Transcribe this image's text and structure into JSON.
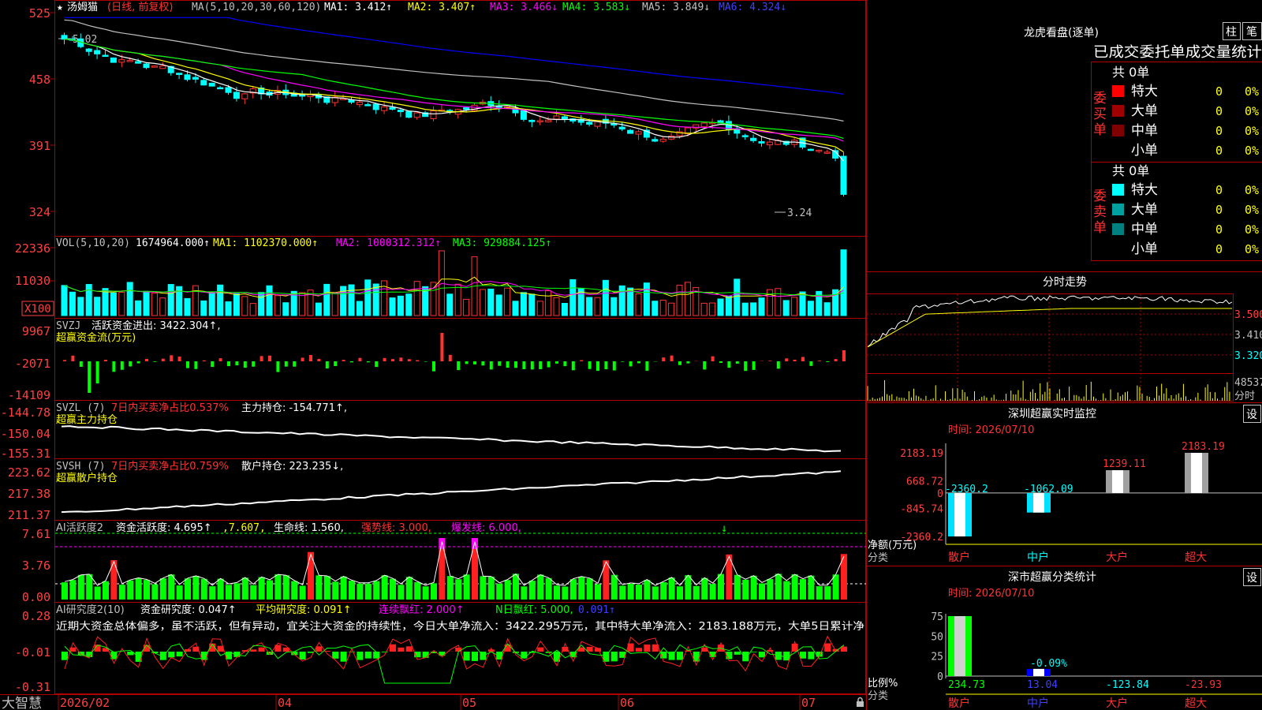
{
  "colors": {
    "up": "#ff3232",
    "down": "#00ffff",
    "green": "#00ff00",
    "grid": "#b00000",
    "ma1": "#ffffff",
    "ma2": "#ffff00",
    "ma3": "#ff00ff",
    "ma4": "#00ff00",
    "ma5": "#c0c0c0",
    "ma6": "#0000ff",
    "label": "#ff4040"
  },
  "icons": [
    "star-icon",
    "lock-icon",
    "arrow-up-icon",
    "arrow-down-icon"
  ],
  "k_panel": {
    "star": "★",
    "name": "汤姆猫",
    "period": "(日线, 前复权)",
    "ma_params": "MA(5,10,20,30,60,120)",
    "ma1": "MA1: 3.412↑",
    "ma2": "MA2: 3.407↑",
    "ma3": "MA3: 3.466↓",
    "ma4": "MA4: 3.583↓",
    "ma5": "MA5: 3.849↓",
    "ma6": "MA6: 4.324↓",
    "high_mark": "5.02",
    "low_mark": "3.24",
    "y_ticks": [
      "525",
      "458",
      "391",
      "324"
    ]
  },
  "vol_panel": {
    "label": "VOL(5,10,20)",
    "value": "1674964.000↑",
    "ma1": "MA1: 1102370.000↑",
    "ma2": "MA2: 1000312.312↑",
    "ma3": "MA3: 929884.125↑",
    "y_ticks": [
      "22336",
      "11030"
    ],
    "unit": "X100"
  },
  "svzj_panel": {
    "label": "SVZJ",
    "line1": "活跃资金进出: 3422.304↑,",
    "line2": "超赢资金流(万元)",
    "y_ticks": [
      "9967",
      "-2071",
      "-14109"
    ]
  },
  "svzl_panel": {
    "label": "SVZL (7)",
    "ratio": "7日内买卖净占比0.537%",
    "hold": "主力持仓: -154.771↑,",
    "sub": "超赢主力持仓",
    "y_ticks": [
      "-144.78",
      "-150.04",
      "-155.31"
    ]
  },
  "svsh_panel": {
    "label": "SVSH (7)",
    "ratio": "7日内买卖净占比0.759%",
    "hold": "散户持仓: 223.235↓,",
    "sub": "超赢散户持仓",
    "y_ticks": [
      "223.62",
      "217.38",
      "211.37"
    ]
  },
  "ai_active": {
    "label": "AI活跃度2",
    "active": "资金活跃度: 4.695↑",
    "v2": ",7.607,",
    "life": "生命线: 1.560,",
    "strong": "强势线: 3.000,",
    "burst": "爆发线: 6.000,",
    "y_ticks": [
      "7.61",
      "3.76",
      "0.00"
    ]
  },
  "ai_research": {
    "label": "AI研究度2(10)",
    "research": "资金研究度: 0.047↑",
    "avg": "平均研究度: 0.091↑",
    "cont": "连续飘红: 2.000↑",
    "n_days": "N日飘红: 5.000,",
    "extra": "0.091↑",
    "comment": "近期大资金总体偏多，虽不活跃，但有异动，宜关注大资金的持续性，今日大单净流入：3422.295万元，其中特大单净流入：2183.188万元，大单5日累计净",
    "y_ticks": [
      "0.28",
      "-0.01",
      "-0.31"
    ]
  },
  "x_axis": {
    "labels": [
      "2026/02",
      "04",
      "05",
      "06",
      "07"
    ],
    "app_name": "大智慧"
  },
  "dragon_panel": {
    "title": "龙虎看盘(逐单)",
    "btn_zhu": "柱",
    "btn_bi": "笔",
    "header": "已成交委托单成交量统计",
    "buy_label": "委买单",
    "sell_label": "委卖单",
    "buy_total": "共 0单",
    "sell_total": "共 0单",
    "rows": [
      {
        "name": "特大",
        "count": "0",
        "pct": "0%"
      },
      {
        "name": "大单",
        "count": "0",
        "pct": "0%"
      },
      {
        "name": "中单",
        "count": "0",
        "pct": "0%"
      },
      {
        "name": "小单",
        "count": "0",
        "pct": "0%"
      }
    ],
    "buy_colors": [
      "#ff0000",
      "#a00000",
      "#800000",
      "#000000"
    ],
    "sell_colors": [
      "#00ffff",
      "#00a0a0",
      "#008080",
      "#000000"
    ]
  },
  "intraday_panel": {
    "title": "分时走势",
    "y_ticks": [
      "3.500",
      "3.410",
      "3.320"
    ],
    "vol_tick": "48537",
    "vol_label": "分时"
  },
  "sz_monitor": {
    "title": "深圳超赢实时监控",
    "btn": "设",
    "time": "时间: 2026/07/10",
    "y_ticks": [
      "2183.19",
      "668.72",
      "0",
      "-845.74",
      "-2360.2"
    ],
    "y_label": "净额(万元)",
    "x_label": "分类"
  },
  "sz_class": {
    "title": "深市超赢分类统计",
    "btn": "设",
    "time": "时间: 2026/07/10",
    "y_ticks": [
      "75",
      "50",
      "25",
      "0"
    ],
    "y_label": "比例%",
    "x_label": "分类"
  },
  "chart_data": [
    {
      "type": "bar",
      "title": "深圳超赢实时监控",
      "categories": [
        "散户",
        "中户",
        "大户",
        "超大"
      ],
      "values": [
        -2360.2,
        -1062.09,
        1239.11,
        2183.19
      ],
      "ylim": [
        -2360.2,
        2183.19
      ],
      "ylabel": "净额(万元)",
      "xlabel": "分类"
    },
    {
      "type": "bar",
      "title": "深市超赢分类统计",
      "categories": [
        "散户",
        "中户",
        "大户",
        "超大"
      ],
      "values": [
        234.73,
        13.04,
        -123.84,
        -23.93
      ],
      "annotations": [
        "-0.09%"
      ],
      "ylim": [
        0,
        75
      ],
      "ylabel": "比例%",
      "xlabel": "分类"
    },
    {
      "type": "line",
      "title": "K线 汤姆猫",
      "series": [
        {
          "name": "MA1",
          "last": 3.412
        },
        {
          "name": "MA2",
          "last": 3.407
        },
        {
          "name": "MA3",
          "last": 3.466
        },
        {
          "name": "MA4",
          "last": 3.583
        },
        {
          "name": "MA5",
          "last": 3.849
        },
        {
          "name": "MA6",
          "last": 4.324
        }
      ],
      "high": 5.02,
      "low": 3.24
    }
  ]
}
